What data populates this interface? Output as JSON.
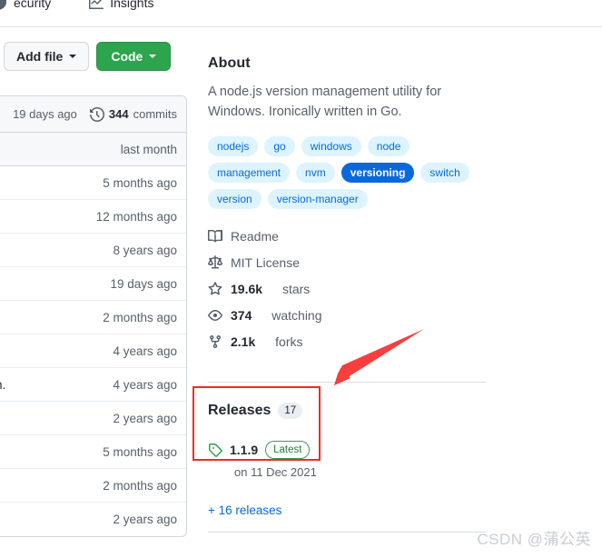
{
  "nav": {
    "tabs": [
      {
        "label": "ecurity",
        "icon": "shield-icon",
        "truncated": true
      },
      {
        "label": "Insights",
        "icon": "graph-icon",
        "truncated": false
      }
    ]
  },
  "toolbar": {
    "stub_button_label": "",
    "add_file_label": "Add file",
    "code_label": "Code"
  },
  "file_list": {
    "header": {
      "last_commit_time": "19 days ago",
      "commits_count": "344",
      "commits_label": "commits",
      "clock_icon": "history-icon"
    },
    "rows": [
      {
        "time": "last month",
        "shaded": true,
        "fragment": ""
      },
      {
        "time": "5 months ago",
        "shaded": false,
        "fragment": ""
      },
      {
        "time": "12 months ago",
        "shaded": false,
        "fragment": ""
      },
      {
        "time": "8 years ago",
        "shaded": false,
        "fragment": ""
      },
      {
        "time": "19 days ago",
        "shaded": false,
        "fragment": ""
      },
      {
        "time": "2 months ago",
        "shaded": false,
        "fragment": ""
      },
      {
        "time": "4 years ago",
        "shaded": false,
        "fragment": ""
      },
      {
        "time": "4 years ago",
        "shaded": false,
        "fragment": "n."
      },
      {
        "time": "2 years ago",
        "shaded": false,
        "fragment": ""
      },
      {
        "time": "5 months ago",
        "shaded": false,
        "fragment": ""
      },
      {
        "time": "2 months ago",
        "shaded": false,
        "fragment": ""
      },
      {
        "time": "2 years ago",
        "shaded": false,
        "fragment": ""
      }
    ]
  },
  "about": {
    "title": "About",
    "description": "A node.js version management utility for Windows. Ironically written in Go.",
    "topics": [
      {
        "label": "nodejs",
        "active": false
      },
      {
        "label": "go",
        "active": false
      },
      {
        "label": "windows",
        "active": false
      },
      {
        "label": "node",
        "active": false
      },
      {
        "label": "management",
        "active": false
      },
      {
        "label": "nvm",
        "active": false
      },
      {
        "label": "versioning",
        "active": true
      },
      {
        "label": "switch",
        "active": false
      },
      {
        "label": "version",
        "active": false
      },
      {
        "label": "version-manager",
        "active": false
      }
    ],
    "stats": [
      {
        "icon": "book-icon",
        "strong": "",
        "text": "Readme"
      },
      {
        "icon": "law-icon",
        "strong": "",
        "text": "MIT License"
      },
      {
        "icon": "star-icon",
        "strong": "19.6k",
        "text": "stars"
      },
      {
        "icon": "eye-icon",
        "strong": "374",
        "text": "watching"
      },
      {
        "icon": "fork-icon",
        "strong": "2.1k",
        "text": "forks"
      }
    ]
  },
  "releases": {
    "title": "Releases",
    "count": "17",
    "latest_version": "1.1.9",
    "latest_badge": "Latest",
    "date": "on 11 Dec 2021",
    "more_link": "+ 16 releases",
    "tag_icon": "tag-icon"
  },
  "annotations": {
    "highlight_color": "#ef2b2b",
    "arrow_color": "#f83e3e"
  },
  "watermark": {
    "text": "CSDN @蒲公英"
  }
}
